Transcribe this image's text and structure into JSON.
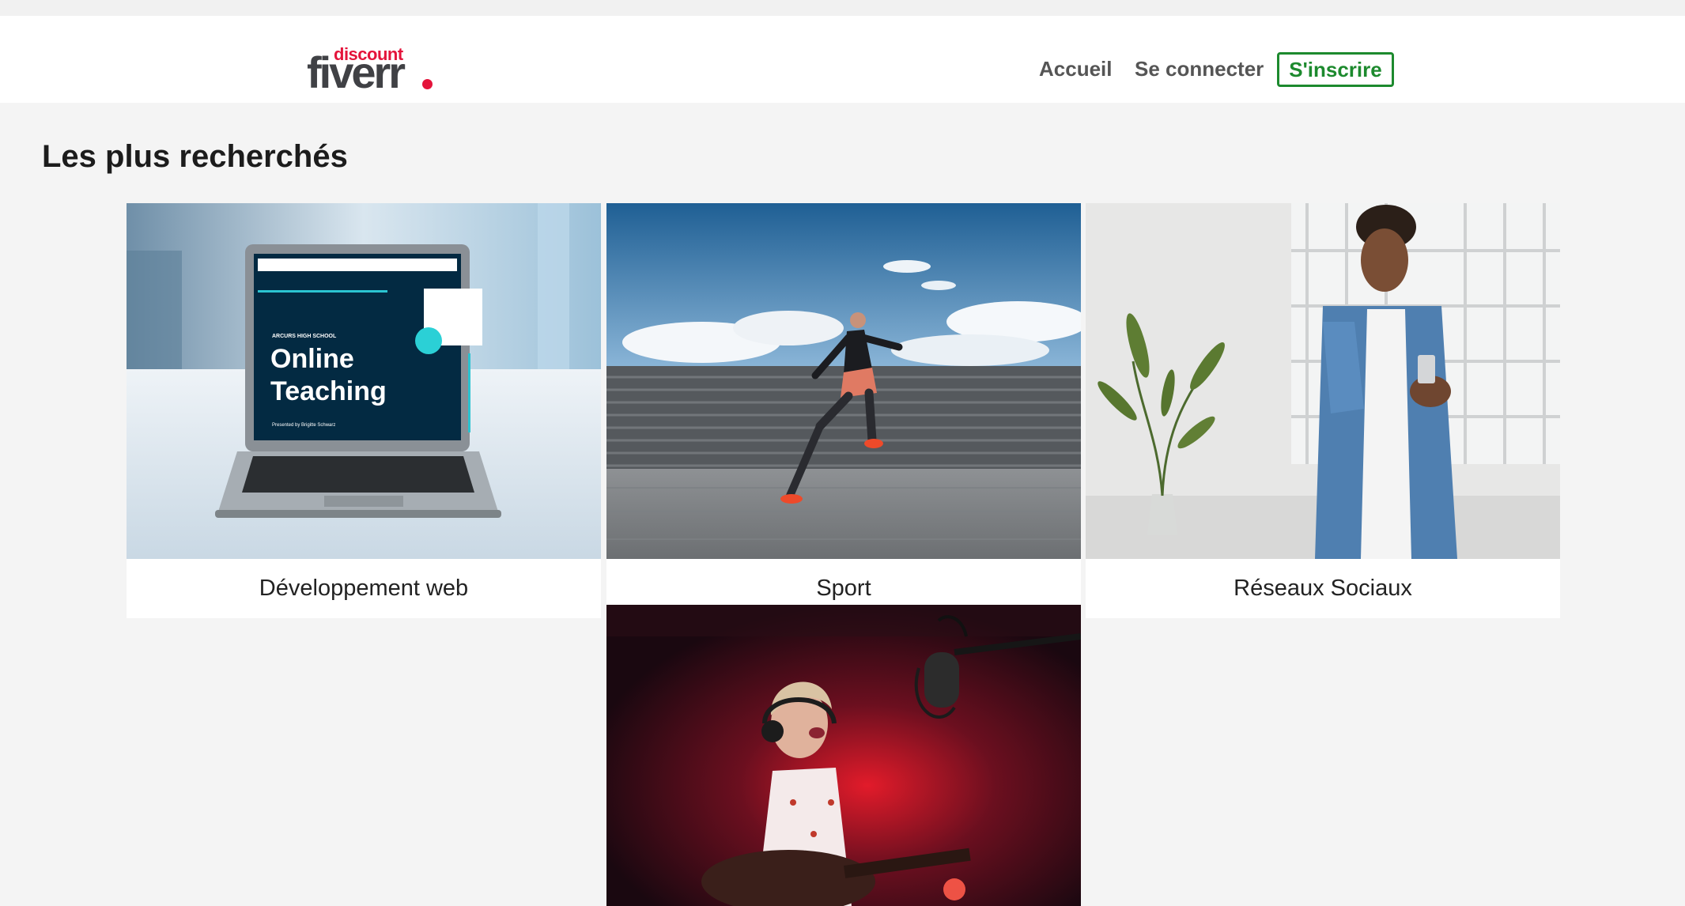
{
  "nav": {
    "logo_small": "discount",
    "logo_main": "fiverr",
    "links": [
      "Accueil",
      "Se connecter"
    ],
    "signup_label": "S'inscrire"
  },
  "colors": {
    "accent_green": "#1d8a2e",
    "logo_red": "#e4143b",
    "page_bg": "#f4f4f4"
  },
  "section": {
    "title": "Les plus recherchés"
  },
  "categories": [
    {
      "label": "Développement web",
      "image": "laptop-online-teaching-photo",
      "screen_small": "ARCURS HIGH SCHOOL",
      "screen_title_1": "Online",
      "screen_title_2": "Teaching",
      "screen_sub": "Presented by Brigitte Schwarz"
    },
    {
      "label": "Sport",
      "image": "woman-running-on-stairs-photo"
    },
    {
      "label": "Réseaux Sociaux",
      "image": "man-with-smartphone-photo"
    },
    {
      "label": "",
      "image": "woman-singing-with-guitar-photo"
    }
  ]
}
